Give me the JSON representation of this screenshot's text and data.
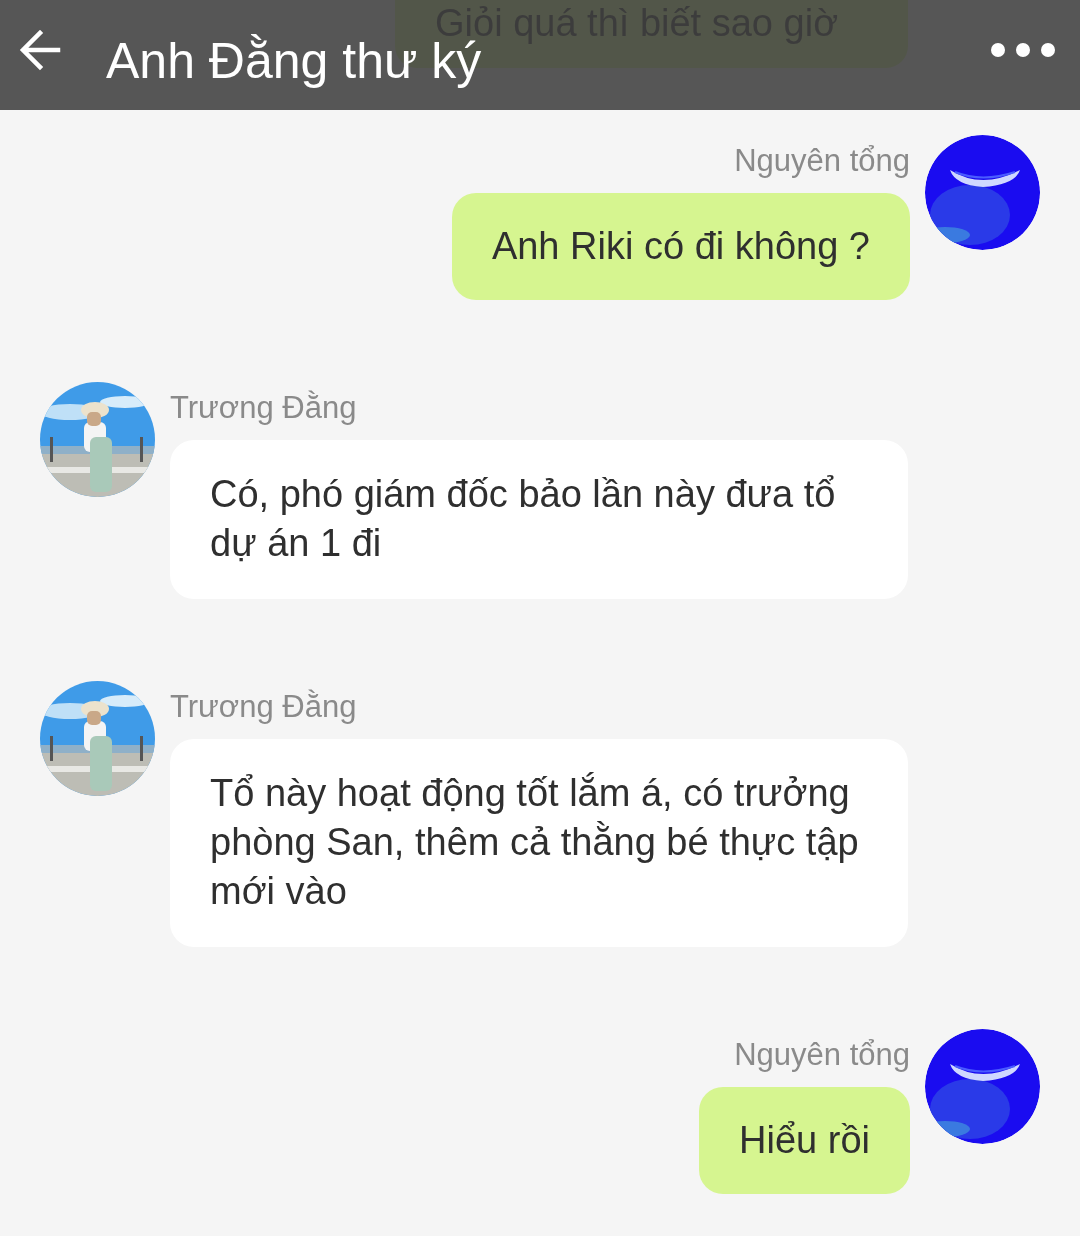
{
  "header": {
    "title": "Anh Đằng thư ký"
  },
  "peek_message": {
    "text": "Giỏi quá thì biết sao giờ"
  },
  "messages": [
    {
      "kind": "outgoing",
      "sender": "Nguyên tổng",
      "text": "Anh Riki có đi không ?"
    },
    {
      "kind": "incoming",
      "sender": "Trương Đằng",
      "text": "Có, phó giám đốc bảo lần này đưa tổ dự án 1 đi"
    },
    {
      "kind": "incoming",
      "sender": "Trương Đằng",
      "text": "Tổ này hoạt động tốt lắm á, có trưởng phòng San, thêm cả thằng bé thực tập mới vào"
    },
    {
      "kind": "outgoing",
      "sender": "Nguyên tổng",
      "text": "Hiểu rồi"
    }
  ]
}
